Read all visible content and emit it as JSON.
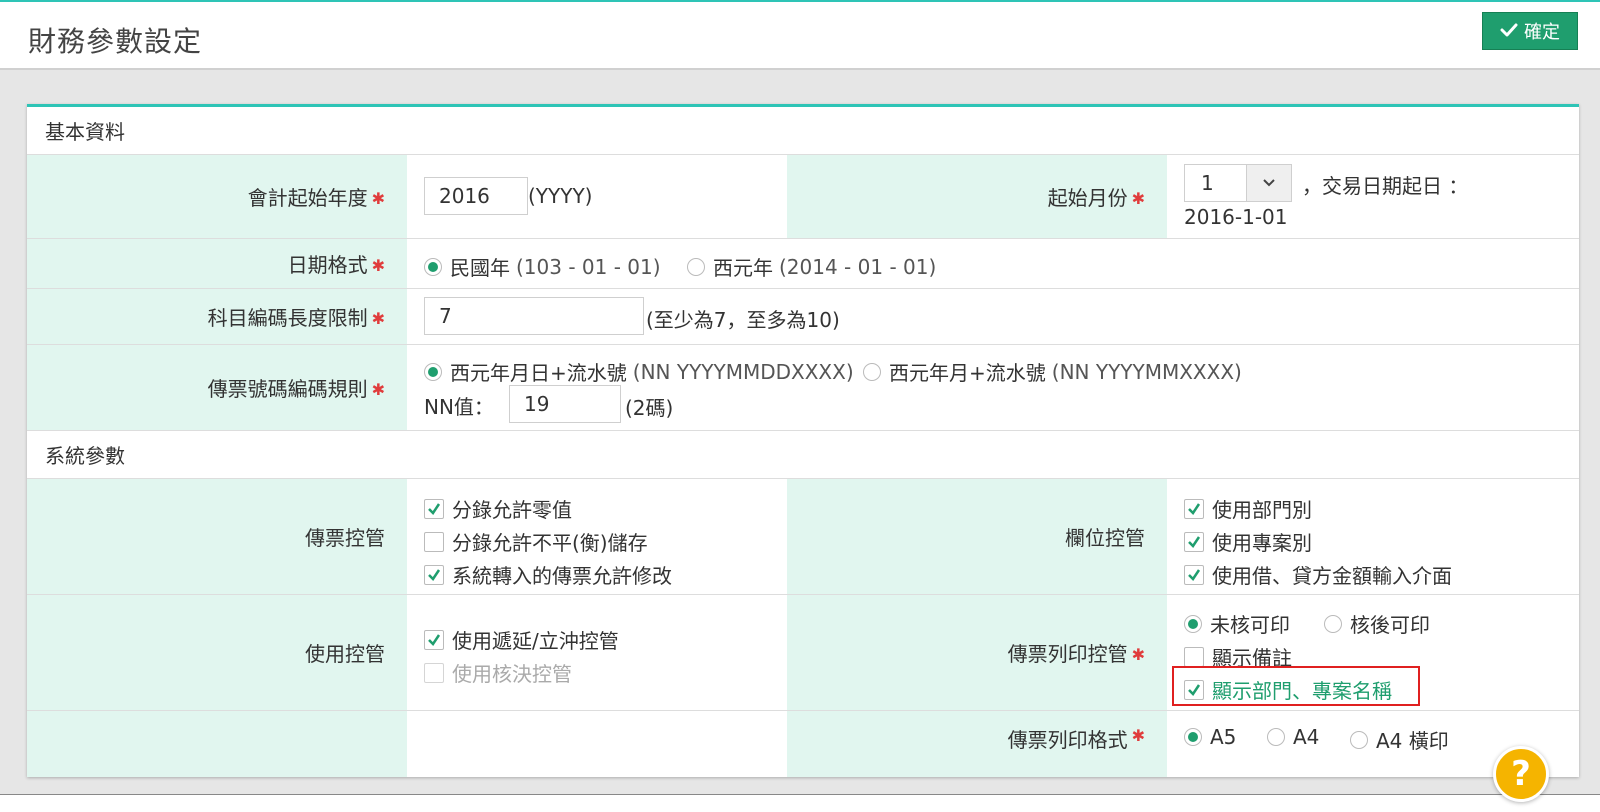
{
  "header": {
    "title": "財務參數設定",
    "confirm_label": "確定"
  },
  "basic": {
    "section_title": "基本資料",
    "fiscal_start_year": {
      "label": "會計起始年度",
      "value": "2016",
      "hint": "(YYYY)"
    },
    "start_month": {
      "label": "起始月份",
      "value": "1",
      "trade_date_label": "，交易日期起日 ：",
      "trade_date_value": "2016-1-01"
    },
    "date_format": {
      "label": "日期格式",
      "options": [
        {
          "main": "民國年",
          "example": "(103 - 01 - 01)",
          "selected": true
        },
        {
          "main": "西元年",
          "example": "(2014 - 01 - 01)",
          "selected": false
        }
      ]
    },
    "account_code_length": {
      "label": "科目編碼長度限制",
      "value": "7",
      "hint": "(至少為7，至多為10)"
    },
    "voucher_number_rule": {
      "label": "傳票號碼編碼規則",
      "options": [
        {
          "main": "西元年月日+流水號",
          "example": "(NN YYYYMMDDXXXX)",
          "selected": true
        },
        {
          "main": "西元年月+流水號",
          "example": "(NN YYYYMMXXXX)",
          "selected": false
        }
      ],
      "nn_label": "NN值：",
      "nn_value": "19",
      "nn_hint": "(2碼)"
    }
  },
  "system": {
    "section_title": "系統參數",
    "voucher_control": {
      "label": "傳票控管",
      "items": [
        {
          "label": "分錄允許零值",
          "checked": true
        },
        {
          "label": "分錄允許不平(衡)儲存",
          "checked": false
        },
        {
          "label": "系統轉入的傳票允許修改",
          "checked": true
        }
      ]
    },
    "field_control": {
      "label": "欄位控管",
      "items": [
        {
          "label": "使用部門別",
          "checked": true
        },
        {
          "label": "使用專案別",
          "checked": true
        },
        {
          "label": "使用借、貸方金額輸入介面",
          "checked": true
        }
      ]
    },
    "usage_control": {
      "label": "使用控管",
      "items": [
        {
          "label": "使用遞延/立沖控管",
          "checked": true
        },
        {
          "label": "使用核決控管",
          "checked": false,
          "disabled": true
        }
      ]
    },
    "print_control": {
      "label": "傳票列印控管",
      "radios": [
        {
          "label": "未核可印",
          "selected": true
        },
        {
          "label": "核後可印",
          "selected": false
        }
      ],
      "show_note": {
        "label": "顯示備註",
        "checked": false
      },
      "show_dept_project": {
        "label": "顯示部門、專案名稱",
        "checked": true
      }
    },
    "print_format": {
      "label": "傳票列印格式",
      "options": [
        {
          "label": "A5",
          "selected": true
        },
        {
          "label": "A4",
          "selected": false
        },
        {
          "label": "A4 橫印",
          "selected": false
        }
      ]
    }
  },
  "help": {
    "symbol": "?"
  },
  "colors": {
    "accent": "#1f9e6e",
    "label_bg": "#e1f6ef",
    "top_line": "#2ec4b6",
    "highlight": "#e02020",
    "help": "#f5b400"
  }
}
